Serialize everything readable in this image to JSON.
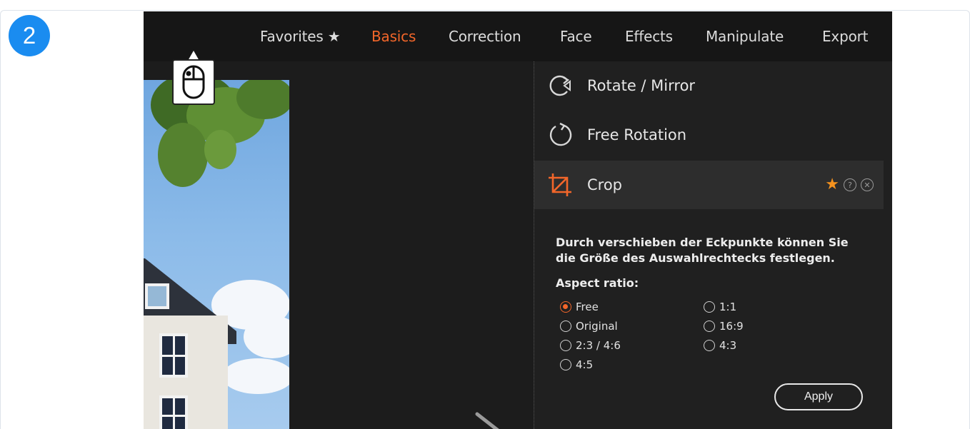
{
  "step": {
    "number": "2"
  },
  "nav": {
    "items": [
      {
        "label": "Favorites ★",
        "active": false
      },
      {
        "label": "Basics",
        "active": true
      },
      {
        "label": "Correction",
        "active": false
      },
      {
        "label": "Face",
        "active": false
      },
      {
        "label": "Effects",
        "active": false
      },
      {
        "label": "Manipulate",
        "active": false
      },
      {
        "label": "Export",
        "active": false
      }
    ]
  },
  "tools": [
    {
      "label": "Rotate / Mirror",
      "icon": "rotate-mirror-icon"
    },
    {
      "label": "Free Rotation",
      "icon": "free-rotation-icon"
    },
    {
      "label": "Crop",
      "icon": "crop-icon",
      "selected": true
    }
  ],
  "crop_panel": {
    "description": "Durch verschieben der Eckpunkte können Sie die Größe des Auswahlrechtecks festlegen.",
    "aspect_title": "Aspect ratio:",
    "options_left": [
      "Free",
      "Original",
      "2:3 / 4:6",
      "4:5"
    ],
    "options_right": [
      "1:1",
      "16:9",
      "4:3"
    ],
    "selected_option": "Free",
    "apply_label": "Apply"
  },
  "colors": {
    "accent": "#f2662a",
    "badge": "#1a8cf0",
    "star": "#f5921e"
  }
}
